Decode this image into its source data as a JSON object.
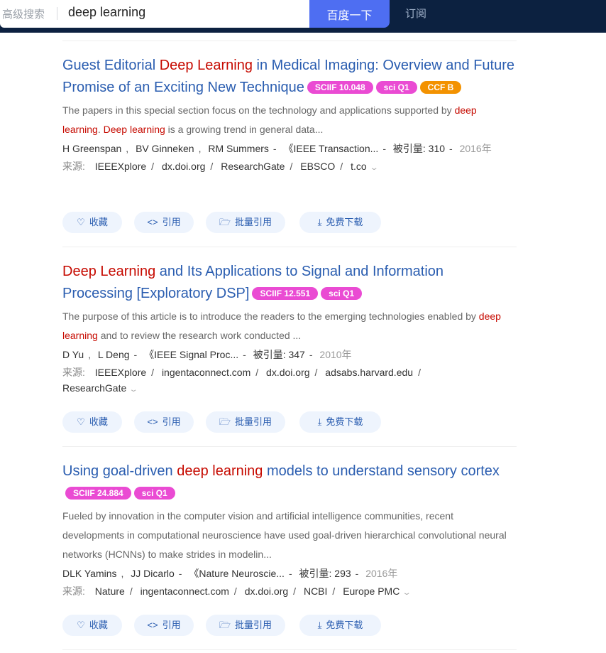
{
  "header": {
    "advanced_search": "高级搜索",
    "query": "deep learning",
    "search_button": "百度一下",
    "subscribe": "订阅"
  },
  "actions": {
    "favorite": "收藏",
    "cite": "引用",
    "batch_cite": "批量引用",
    "free_download": "免费下载"
  },
  "source_label": "来源:",
  "results": [
    {
      "title_pre": "Guest Editorial ",
      "title_hl": "Deep Learning",
      "title_post": " in Medical Imaging: Overview and Future Promise of an Exciting New Technique",
      "badges": [
        "SCIIF 10.048",
        "sci Q1",
        "CCF B"
      ],
      "abstract_pre": "The papers in this special section focus on the technology and applications supported by ",
      "abstract_hl1": "deep learning",
      "abstract_mid": ". ",
      "abstract_hl2": "Deep learning",
      "abstract_post": " is a growing trend in general data...",
      "authors": [
        "H Greenspan",
        "BV Ginneken",
        "RM Summers"
      ],
      "journal": "《IEEE Transaction...",
      "citations_label": "被引量:",
      "citations": "310",
      "year": "2016年",
      "sources": [
        "IEEEXplore",
        "dx.doi.org",
        "ResearchGate",
        "EBSCO",
        "t.co"
      ]
    },
    {
      "title_hl": "Deep Learning",
      "title_post": " and Its Applications to Signal and Information Processing [Exploratory DSP]",
      "badges": [
        "SCIIF 12.551",
        "sci Q1"
      ],
      "abstract_pre": "The purpose of this article is to introduce the readers to the emerging technologies enabled by ",
      "abstract_hl1": "deep learning",
      "abstract_post": " and to review the research work conducted ...",
      "authors": [
        "D Yu",
        "L Deng"
      ],
      "journal": "《IEEE Signal Proc...",
      "citations_label": "被引量:",
      "citations": "347",
      "year": "2010年",
      "sources": [
        "IEEEXplore",
        "ingentaconnect.com",
        "dx.doi.org",
        "adsabs.harvard.edu",
        "ResearchGate"
      ]
    },
    {
      "title_pre": "Using goal-driven ",
      "title_hl": "deep learning",
      "title_post": " models to understand sensory cortex",
      "badges": [
        "SCIIF 24.884",
        "sci Q1"
      ],
      "abstract_pre": "Fueled by innovation in the computer vision and artificial intelligence communities, recent developments in computational neuroscience have used goal-driven hierarchical convolutional neural networks (HCNNs) to make strides in modelin...",
      "authors": [
        "DLK Yamins",
        "JJ Dicarlo"
      ],
      "journal": "《Nature Neuroscie...",
      "citations_label": "被引量:",
      "citations": "293",
      "year": "2016年",
      "sources": [
        "Nature",
        "ingentaconnect.com",
        "dx.doi.org",
        "NCBI",
        "Europe PMC"
      ]
    }
  ],
  "colors": {
    "topbar": "#0c2140",
    "search_button": "#4e6ef2",
    "title_link": "#2a5db0",
    "highlight": "#c60a00",
    "badge_pink": "#ea4bd3",
    "badge_orange": "#f39200",
    "action_bg": "#eef4fd"
  },
  "icons": {
    "favorite": "heart-icon",
    "cite": "code-brackets-icon",
    "batch_cite": "folder-plus-icon",
    "download": "download-icon",
    "expand": "chevron-down-icon"
  }
}
